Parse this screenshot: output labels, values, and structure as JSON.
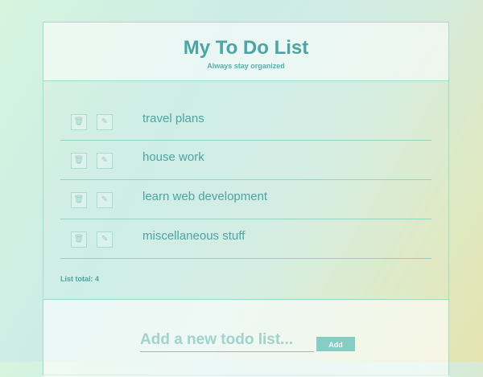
{
  "header": {
    "title": "My To Do List",
    "subtitle": "Always stay organized"
  },
  "items": [
    {
      "label": "travel plans",
      "delete_icon": "trash-icon",
      "edit_icon": "pencil-icon"
    },
    {
      "label": "house work",
      "delete_icon": "trash-icon",
      "edit_icon": "pencil-icon"
    },
    {
      "label": "learn web development",
      "delete_icon": "trash-icon",
      "edit_icon": "pencil-icon"
    },
    {
      "label": "miscellaneous stuff",
      "delete_icon": "trash-icon",
      "edit_icon": "pencil-icon"
    }
  ],
  "total_text": "List total: 4",
  "add": {
    "placeholder": "Add a new todo list...",
    "button_label": "Add"
  },
  "colors": {
    "accent": "#4aa5a3",
    "button": "#86cdc3"
  }
}
